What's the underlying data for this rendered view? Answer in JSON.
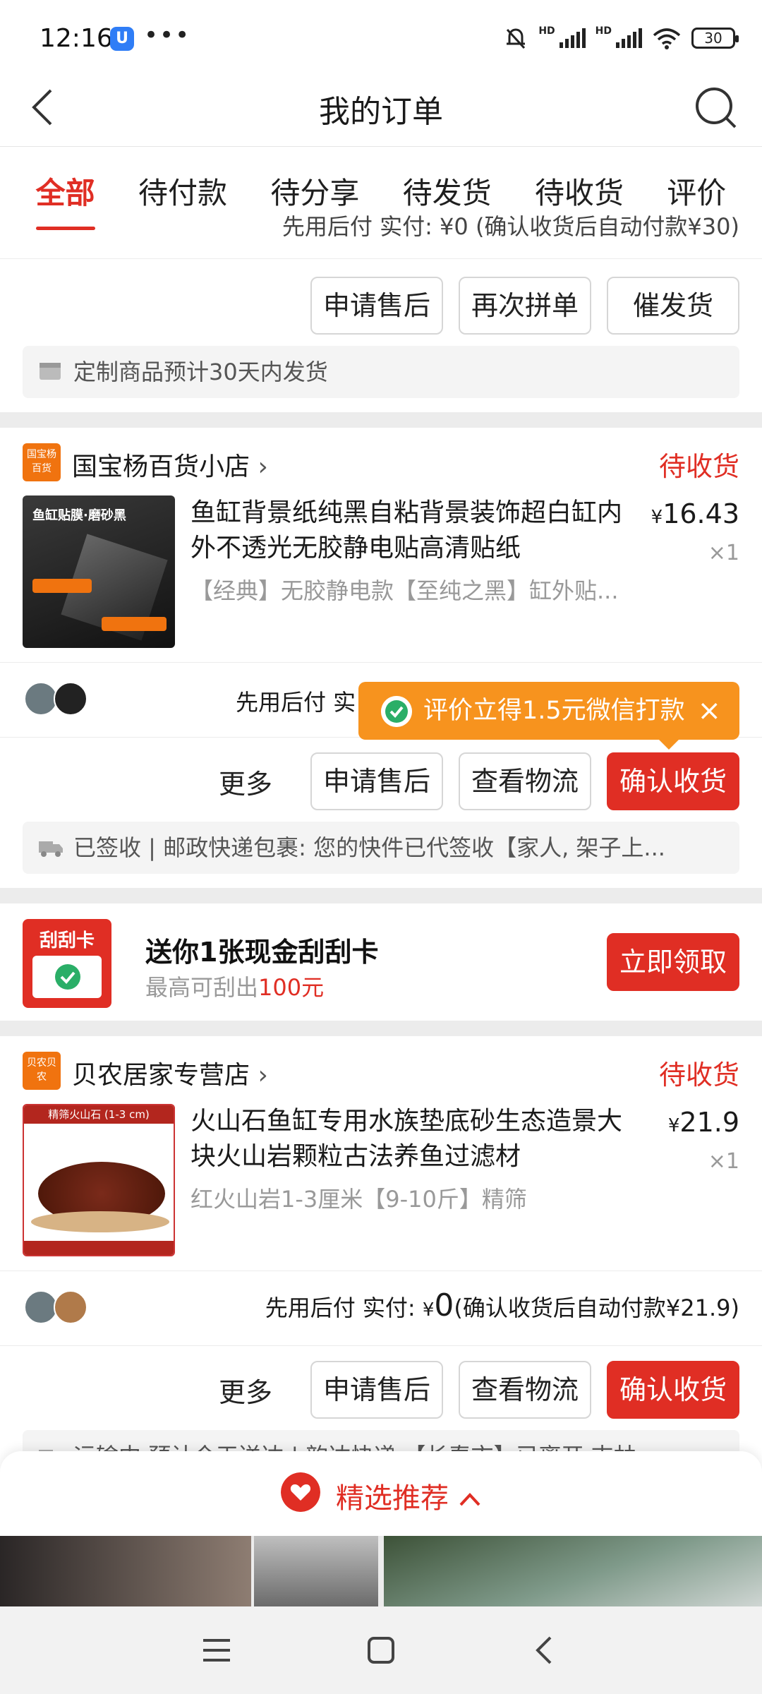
{
  "status_bar": {
    "time": "12:16",
    "battery": "30",
    "hd1": "HD",
    "hd2": "HD"
  },
  "header": {
    "title": "我的订单"
  },
  "tabs": [
    "全部",
    "待付款",
    "待分享",
    "待发货",
    "待收货",
    "评价"
  ],
  "card0": {
    "partial_text": "先用后付 实付: ¥0 (确认收货后自动付款¥30)",
    "buttons": [
      "申请售后",
      "再次拼单",
      "催发货"
    ],
    "notice": "定制商品预计30天内发货"
  },
  "order1": {
    "shop_logo": "国宝杨百货",
    "shop_name": "国宝杨百货小店",
    "status": "待收货",
    "thumb_title": "鱼缸贴膜·磨砂黑",
    "title": "鱼缸背景纸纯黑自粘背景装饰超白缸内外不透光无胶静电贴高清贴纸",
    "spec": "【经典】无胶静电款【至纯之黑】缸外贴...",
    "price_symbol": "¥",
    "price": "16.43",
    "qty": "×1",
    "pay_text": "先用后付 实",
    "more": "更多",
    "buttons": [
      "申请售后",
      "查看物流",
      "确认收货"
    ],
    "notice": "已签收 | 邮政快递包裹: 您的快件已代签收【家人, 架子上..."
  },
  "tooltip": {
    "text": "评价立得1.5元微信打款",
    "close": "×"
  },
  "promo": {
    "badge": "刮刮卡",
    "title": "送你1张现金刮刮卡",
    "subtitle_prefix": "最高可刮出",
    "subtitle_amount": "100元",
    "button": "立即领取"
  },
  "order2": {
    "shop_logo": "贝农贝农",
    "shop_name": "贝农居家专营店",
    "status": "待收货",
    "thumb_title": "精筛火山石 (1-3 cm)",
    "title": "火山石鱼缸专用水族垫底砂生态造景大块火山岩颗粒古法养鱼过滤材",
    "spec": "红火山岩1-3厘米【9-10斤】精筛",
    "price_symbol": "¥",
    "price": "21.9",
    "qty": "×1",
    "pay_prefix": "先用后付 实付:",
    "pay_symbol": "¥",
    "pay_amount": "0",
    "pay_suffix": "(确认收货后自动付款¥21.9)",
    "more": "更多",
    "buttons": [
      "申请售后",
      "查看物流",
      "确认收货"
    ],
    "notice": "运输中 预计今天送达 | 韵达快递 【长春市】已离开 吉林..."
  },
  "recommend": {
    "label": "精选推荐",
    "chevron": "^"
  },
  "colors": {
    "accent": "#e02e24",
    "tooltip": "#f7931e",
    "shop_logo": "#f0730f"
  }
}
